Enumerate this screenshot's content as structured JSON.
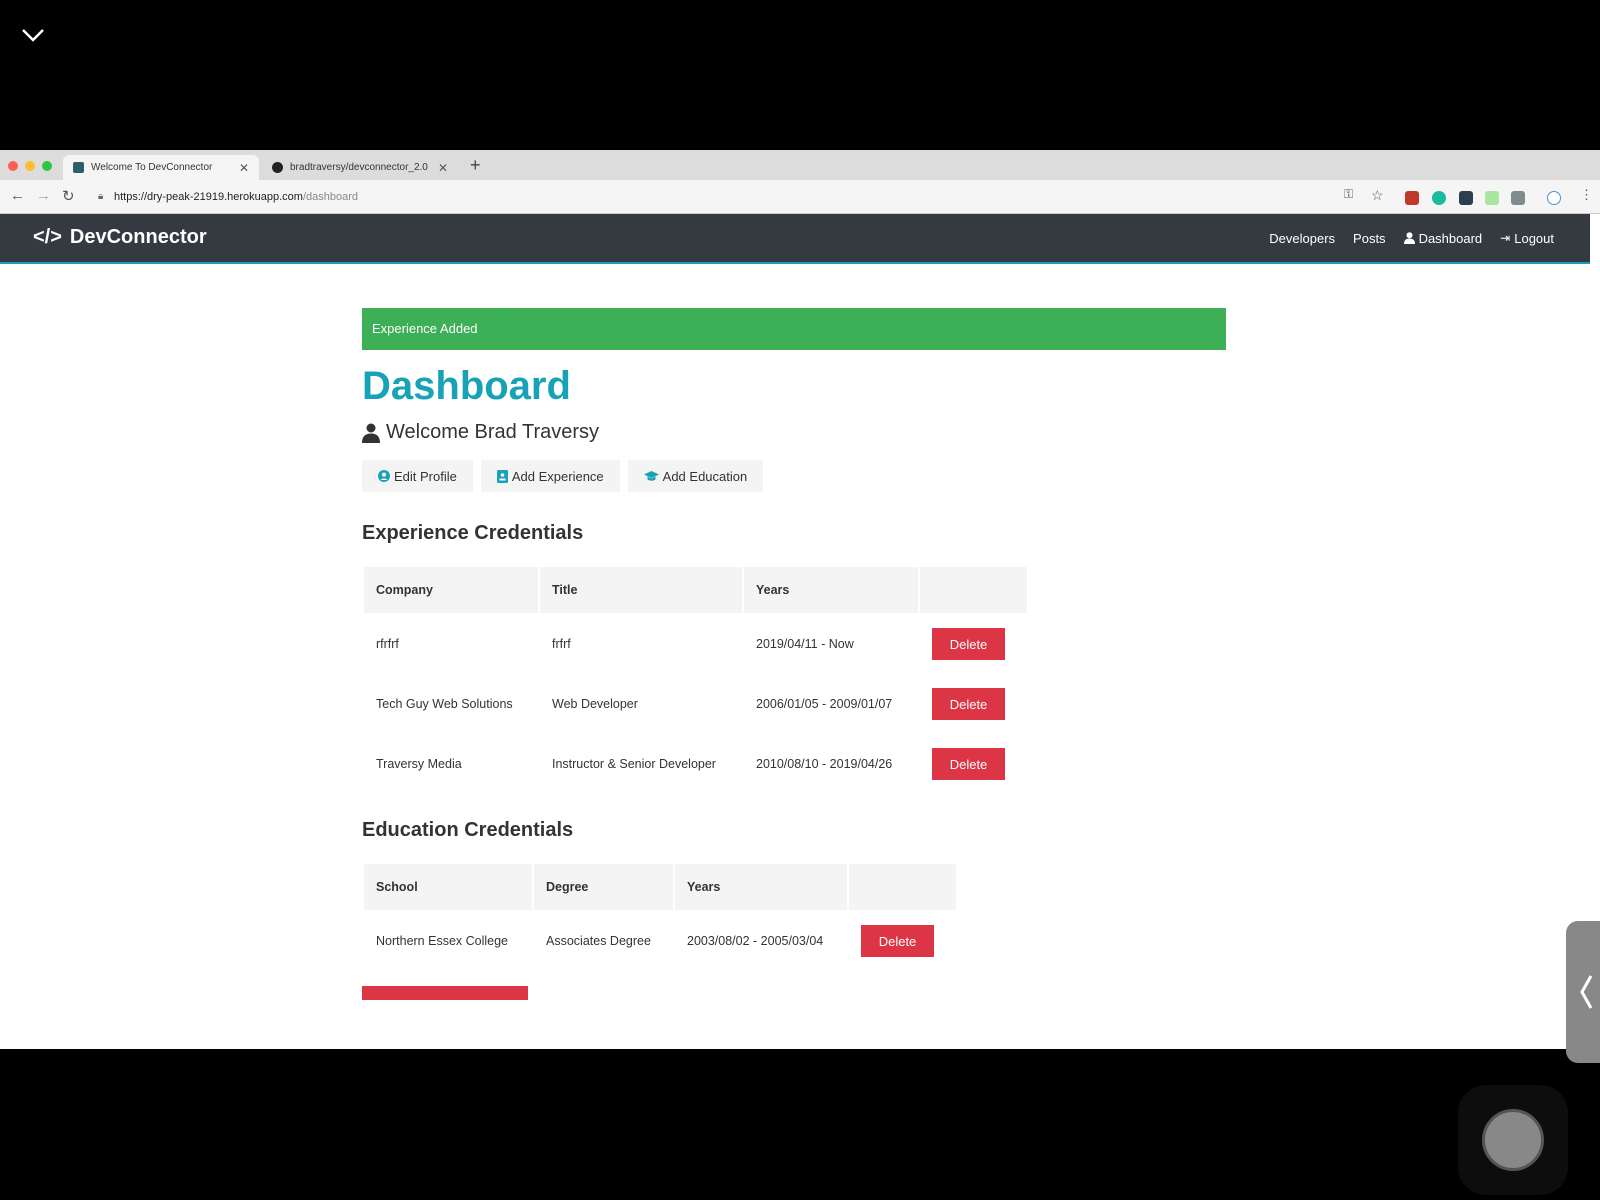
{
  "browser": {
    "tabs": [
      {
        "label": "Welcome To DevConnector"
      },
      {
        "label": "bradtraversy/devconnector_2.0"
      }
    ],
    "url_host": "https://dry-peak-21919.herokuapp.com",
    "url_path": "/dashboard"
  },
  "navbar": {
    "brand": "DevConnector",
    "links": [
      "Developers",
      "Posts",
      "Dashboard",
      "Logout"
    ]
  },
  "alert": {
    "text": "Experience Added"
  },
  "page": {
    "title": "Dashboard",
    "welcome": "Welcome Brad Traversy",
    "actions": [
      "Edit Profile",
      "Add Experience",
      "Add Education"
    ]
  },
  "experience": {
    "heading": "Experience Credentials",
    "headers": [
      "Company",
      "Title",
      "Years"
    ],
    "rows": [
      {
        "company": "rfrfrf",
        "title": "frfrf",
        "years": "2019/04/11 - Now"
      },
      {
        "company": "Tech Guy Web Solutions",
        "title": "Web Developer",
        "years": "2006/01/05 - 2009/01/07"
      },
      {
        "company": "Traversy Media",
        "title": "Instructor & Senior Developer",
        "years": "2010/08/10 - 2019/04/26"
      }
    ],
    "delete_label": "Delete"
  },
  "education": {
    "heading": "Education Credentials",
    "headers": [
      "School",
      "Degree",
      "Years"
    ],
    "rows": [
      {
        "school": "Northern Essex College",
        "degree": "Associates Degree",
        "years": "2003/08/02 - 2005/03/04"
      }
    ],
    "delete_label": "Delete"
  },
  "colors": {
    "primary": "#17a2b8",
    "success": "#28a745",
    "danger": "#dc3545",
    "navbar": "#343a40"
  }
}
